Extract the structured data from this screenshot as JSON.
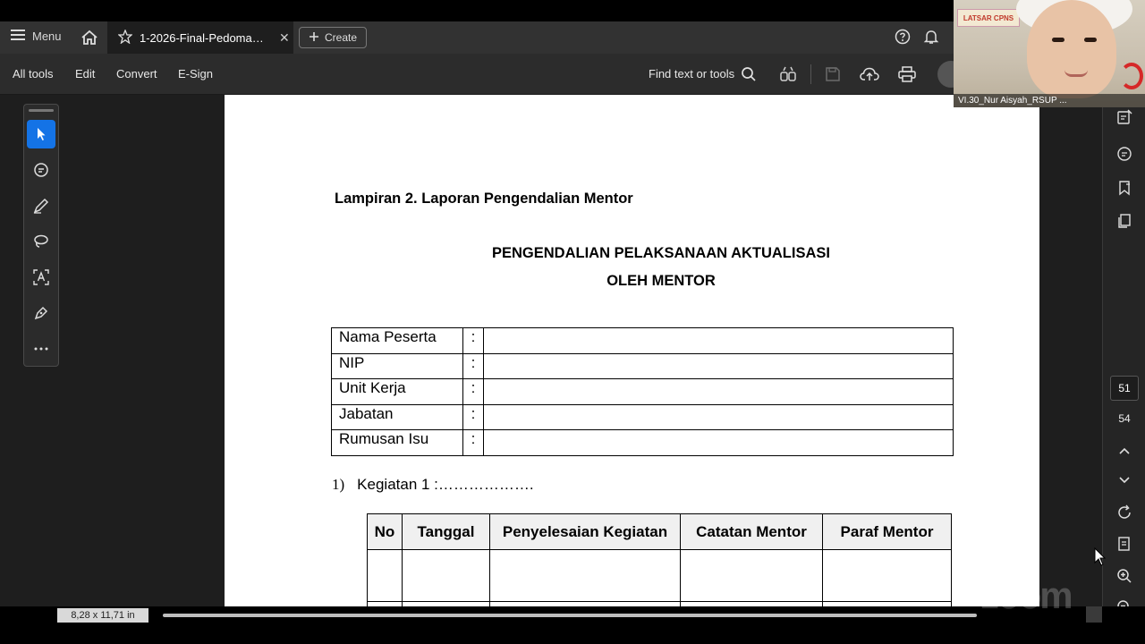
{
  "tabbar": {
    "menu_label": "Menu",
    "doc_tab_title": "1-2026-Final-Pedoman ...",
    "close_glyph": "✕",
    "create_label": "Create"
  },
  "toolbar": {
    "all_tools": "All tools",
    "edit": "Edit",
    "convert": "Convert",
    "esign": "E-Sign",
    "find_text": "Find text or tools"
  },
  "document": {
    "lampiran": "Lampiran 2. Laporan Pengendalian Mentor",
    "title_line1": "PENGENDALIAN PELAKSANAAN AKTUALISASI",
    "title_line2": "OLEH MENTOR",
    "info_rows": [
      {
        "label": "Nama Peserta",
        "sep": ":"
      },
      {
        "label": "NIP",
        "sep": ":"
      },
      {
        "label": "Unit  Kerja",
        "sep": ":"
      },
      {
        "label": "Jabatan",
        "sep": ":"
      },
      {
        "label": "Rumusan Isu",
        "sep": ":"
      }
    ],
    "kegiatan_num": "1)",
    "kegiatan_text": "Kegiatan 1 :……………….",
    "table_headers": [
      "No",
      "Tanggal",
      "Penyelesaian Kegiatan",
      "Catatan Mentor",
      "Paraf Mentor"
    ]
  },
  "navigation": {
    "current_page": "51",
    "total_pages": "54"
  },
  "status": {
    "page_size": "8,28 x 11,71 in"
  },
  "video": {
    "participant_name": "VI.30_Nur Aisyah_RSUP ...",
    "banner_text": "LATSAR CPNS"
  },
  "watermark": "zoom",
  "colors": {
    "accent": "#1473e6",
    "chrome_dark": "#2c2c2c",
    "tab_bar": "#323232",
    "canvas": "#1e1e1e"
  },
  "icons": {
    "left_rail": [
      "select-arrow-icon",
      "comment-icon",
      "pen-icon",
      "lasso-icon",
      "text-recognition-icon",
      "fill-sign-icon",
      "more-icon"
    ],
    "right_rail": [
      "edit-pdf-icon",
      "comments-panel-icon",
      "bookmark-icon",
      "pages-icon",
      "chevron-up-icon",
      "chevron-down-icon",
      "rotate-icon",
      "page-fit-icon",
      "zoom-in-icon",
      "zoom-out-icon"
    ]
  }
}
